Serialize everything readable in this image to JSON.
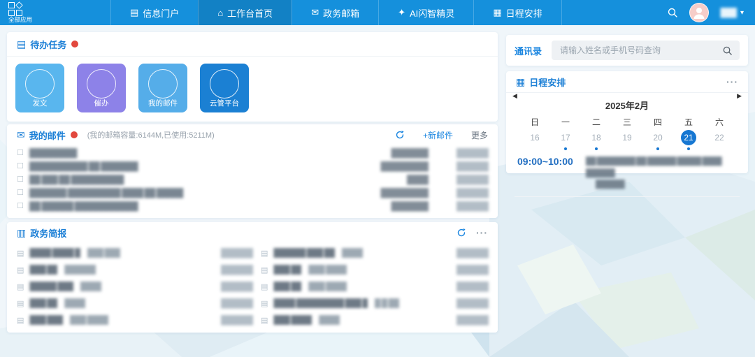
{
  "topbar": {
    "logo_label": "全部应用",
    "nav": [
      {
        "name": "nav-info-portal",
        "icon_name": "info-portal-icon",
        "icon": "▤",
        "label": "信息门户",
        "active": false
      },
      {
        "name": "nav-workbench-home",
        "icon_name": "workbench-icon",
        "icon": "⌂",
        "label": "工作台首页",
        "active": true
      },
      {
        "name": "nav-gov-mailbox",
        "icon_name": "mailbox-icon",
        "icon": "✉",
        "label": "政务邮箱",
        "active": false
      },
      {
        "name": "nav-ai-assistant",
        "icon_name": "ai-sprite-icon",
        "icon": "✦",
        "label": "AI闪智精灵",
        "active": false
      },
      {
        "name": "nav-schedule",
        "icon_name": "calendar-icon",
        "icon": "▦",
        "label": "日程安排",
        "active": false
      }
    ],
    "user_name_masked": "███",
    "caret": "▾"
  },
  "todo": {
    "icon": "▤",
    "title": "待办任务",
    "tiles": [
      {
        "label": "发文",
        "color": "#59b6ee"
      },
      {
        "label": "催办",
        "color": "#8d82e8"
      },
      {
        "label": "我的邮件",
        "color": "#55ade9"
      },
      {
        "label": "云管平台",
        "color": "#1b80d3"
      }
    ]
  },
  "mail": {
    "icon": "✉",
    "title": "我的邮件",
    "quota": "(我的邮箱容量:6144M,已使用:5211M)",
    "new_mail_label": "+新邮件",
    "more_label": "更多",
    "row_icon": "☐",
    "rows": [
      {
        "subject": "█████████",
        "sender": "███████",
        "date": "██████"
      },
      {
        "subject": "███████████ ██ ███████",
        "sender": "█████████",
        "date": "██████"
      },
      {
        "subject": "██ ███ ██ ██████████",
        "sender": "████",
        "date": "██████"
      },
      {
        "subject": "███████ ██████████ ████ ██ █████",
        "sender": "█████████",
        "date": "██████"
      },
      {
        "subject": "██ ██████ ████████████",
        "sender": "███████",
        "date": "██████"
      }
    ]
  },
  "briefing": {
    "icon": "▥",
    "title": "政务简报",
    "more": "···",
    "item_icon": "▤",
    "left": [
      {
        "title": "████ ████ █",
        "source": "███ ███",
        "date": "██████"
      },
      {
        "title": "███ ██",
        "source": "██████",
        "date": "██████"
      },
      {
        "title": "█████ ███",
        "source": "████",
        "date": "██████"
      },
      {
        "title": "███ ██",
        "source": "████",
        "date": "██████"
      },
      {
        "title": "███ ███",
        "source": "███ ████",
        "date": "██████"
      }
    ],
    "right": [
      {
        "title": "██████ ███ ██",
        "source": "████",
        "date": "██████"
      },
      {
        "title": "███ ██",
        "source": "███ ████",
        "date": "██████"
      },
      {
        "title": "███ ██",
        "source": "███ ████",
        "date": "██████"
      },
      {
        "title": "████ █████████ ███ █",
        "source": "█ █ ██",
        "date": "██████"
      },
      {
        "title": "███ ████",
        "source": "████",
        "date": "██████"
      }
    ]
  },
  "contacts": {
    "title": "通讯录",
    "search_placeholder": "请输入姓名或手机号码查询"
  },
  "schedule": {
    "icon": "▦",
    "title": "日程安排",
    "more": "···",
    "month_label": "2025年2月",
    "prev": "◀",
    "next": "▶",
    "days": [
      {
        "weekday": "日",
        "date": "16",
        "dot": false,
        "selected": false
      },
      {
        "weekday": "一",
        "date": "17",
        "dot": true,
        "selected": false
      },
      {
        "weekday": "二",
        "date": "18",
        "dot": true,
        "selected": false
      },
      {
        "weekday": "三",
        "date": "19",
        "dot": false,
        "selected": false
      },
      {
        "weekday": "四",
        "date": "20",
        "dot": true,
        "selected": false
      },
      {
        "weekday": "五",
        "date": "21",
        "dot": true,
        "selected": true
      },
      {
        "weekday": "六",
        "date": "22",
        "dot": false,
        "selected": false
      }
    ],
    "event_time": "09:00~10:00",
    "event_line1": "██ ████████ ██ ██████ █████ ████ ██████",
    "event_line2": "██████"
  }
}
